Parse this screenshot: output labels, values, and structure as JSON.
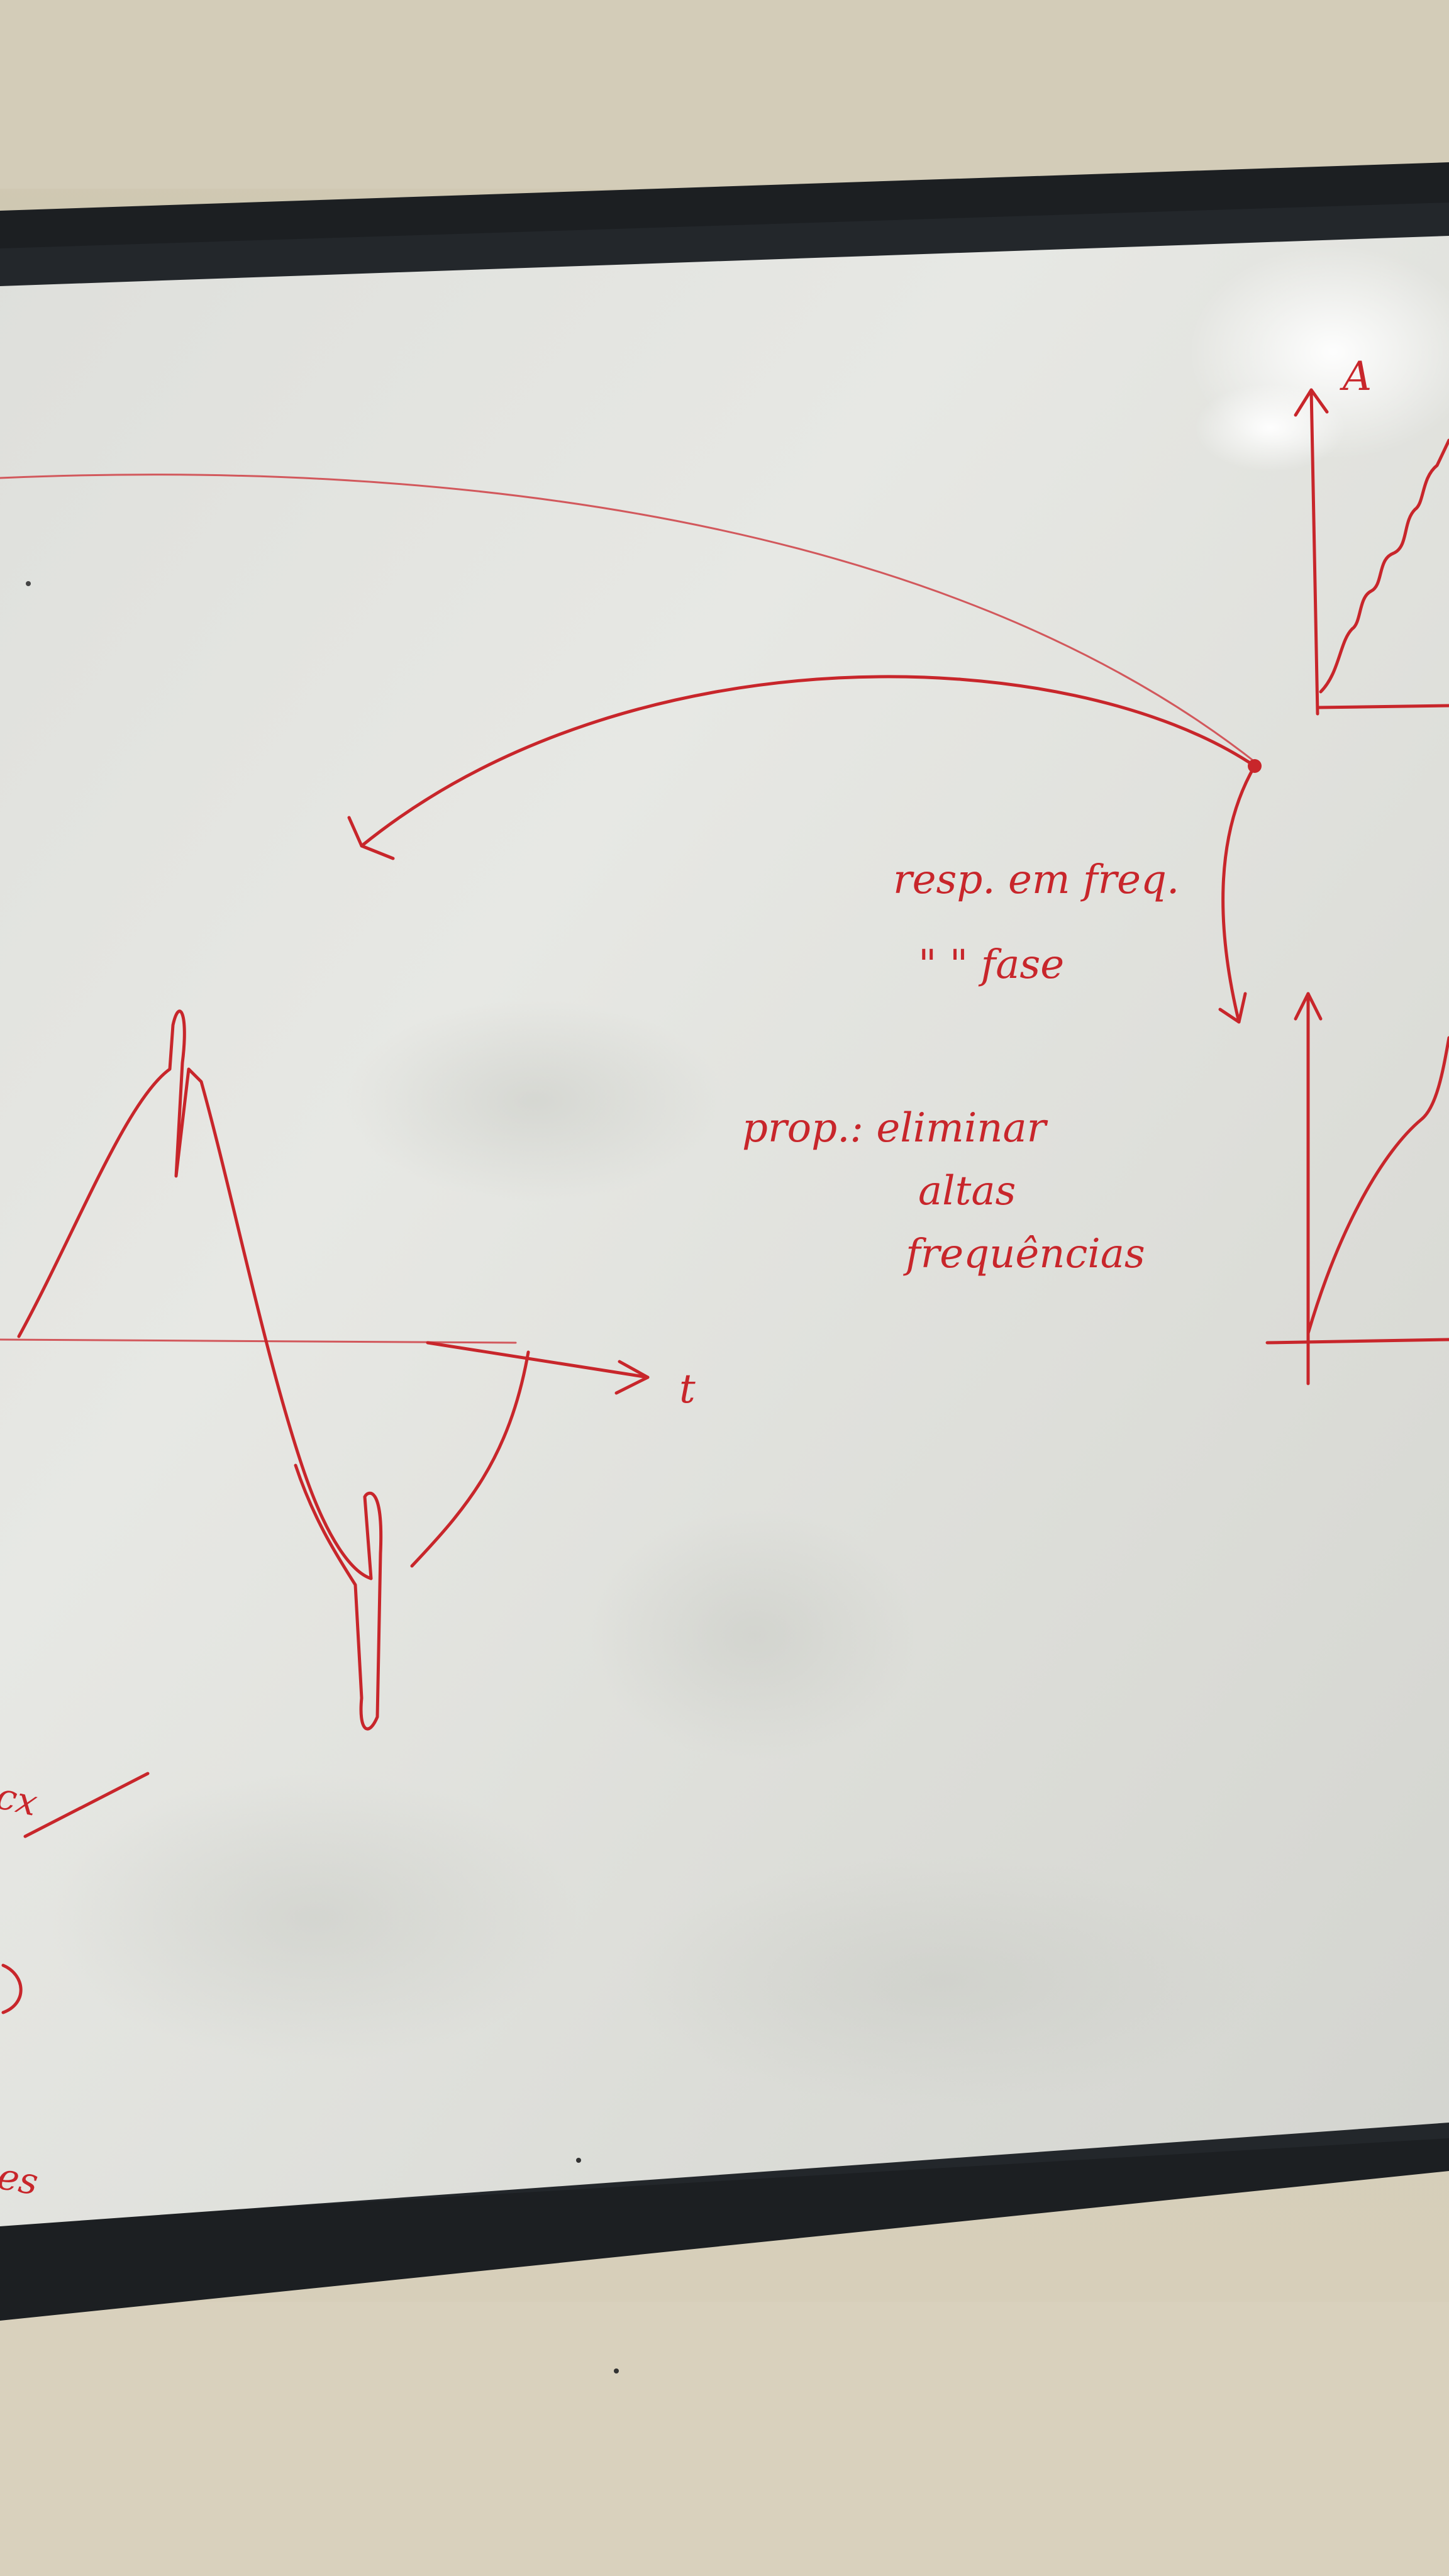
{
  "board": {
    "label_resp_freq": "resp. em freq.",
    "label_ditto_fase": "\" \" fase",
    "label_prop": "prop.: eliminar",
    "label_altas": "altas",
    "label_frequencias": "frequências",
    "axis_t": "t",
    "axis_A": "A",
    "edge_text_1": "cx",
    "edge_text_2": "tes"
  },
  "colors": {
    "marker": "#c8262b",
    "board": "#e4e4e0",
    "frame": "#1c1f22",
    "wall": "#d8d0bb"
  }
}
